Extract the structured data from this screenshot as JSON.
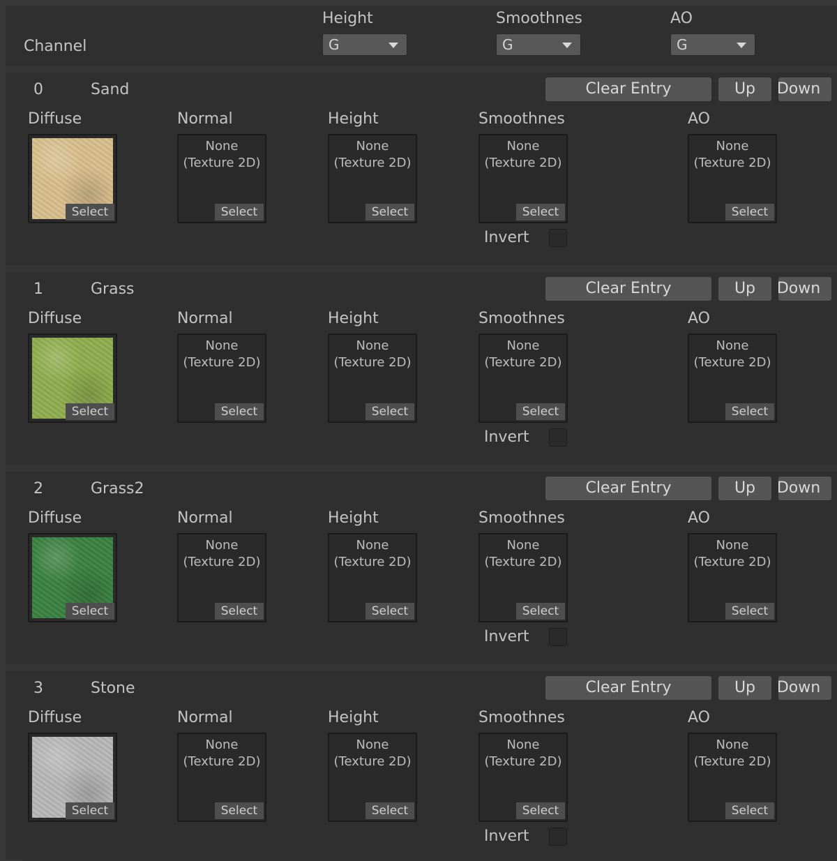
{
  "header": {
    "channel_label": "Channel",
    "columns": [
      {
        "label": "Height",
        "value": "G"
      },
      {
        "label": "Smoothnes",
        "value": "G"
      },
      {
        "label": "AO",
        "value": "G"
      }
    ]
  },
  "slot_labels": [
    "Diffuse",
    "Normal",
    "Height",
    "Smoothnes",
    "AO"
  ],
  "empty_texture_text": "None\n(Texture 2D)",
  "select_label": "Select",
  "invert_label": "Invert",
  "buttons": {
    "clear": "Clear Entry",
    "up": "Up",
    "down": "Down"
  },
  "entries": [
    {
      "index": "0",
      "name": "Sand",
      "diffuse_color": "#d9bf8c",
      "invert": false
    },
    {
      "index": "1",
      "name": "Grass",
      "diffuse_color": "#8fae4e",
      "invert": false
    },
    {
      "index": "2",
      "name": "Grass2",
      "diffuse_color": "#3a8241",
      "invert": false
    },
    {
      "index": "3",
      "name": "Stone",
      "diffuse_color": "#b8b8b8",
      "invert": false
    }
  ]
}
